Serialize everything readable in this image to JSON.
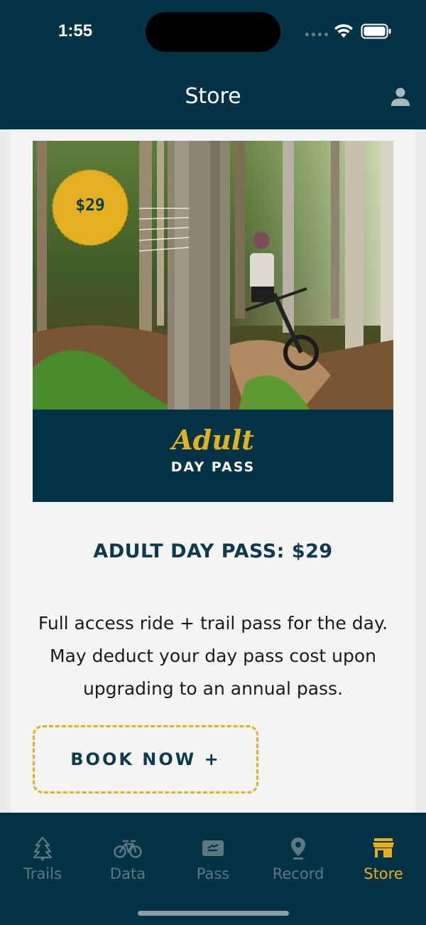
{
  "status_bar": {
    "time": "1:55"
  },
  "header": {
    "title": "Store",
    "profile_icon": "person-icon"
  },
  "product": {
    "price_badge": "$29",
    "banner_script": "Adult",
    "banner_sub": "DAY PASS",
    "title": "ADULT DAY PASS: $29",
    "description": "Full access ride + trail pass for the day. May deduct your day pass cost upon upgrading to an annual pass.",
    "book_button": "BOOK NOW +"
  },
  "tabs": [
    {
      "label": "Trails",
      "icon": "tree-icon",
      "active": false
    },
    {
      "label": "Data",
      "icon": "bike-icon",
      "active": false
    },
    {
      "label": "Pass",
      "icon": "ticket-icon",
      "active": false
    },
    {
      "label": "Record",
      "icon": "location-pin-icon",
      "active": false
    },
    {
      "label": "Store",
      "icon": "store-icon",
      "active": true
    }
  ],
  "colors": {
    "navy": "#043346",
    "accent_yellow": "#e3b021",
    "title_navy": "#0d3a4d",
    "inactive_tab": "#5b7883"
  }
}
